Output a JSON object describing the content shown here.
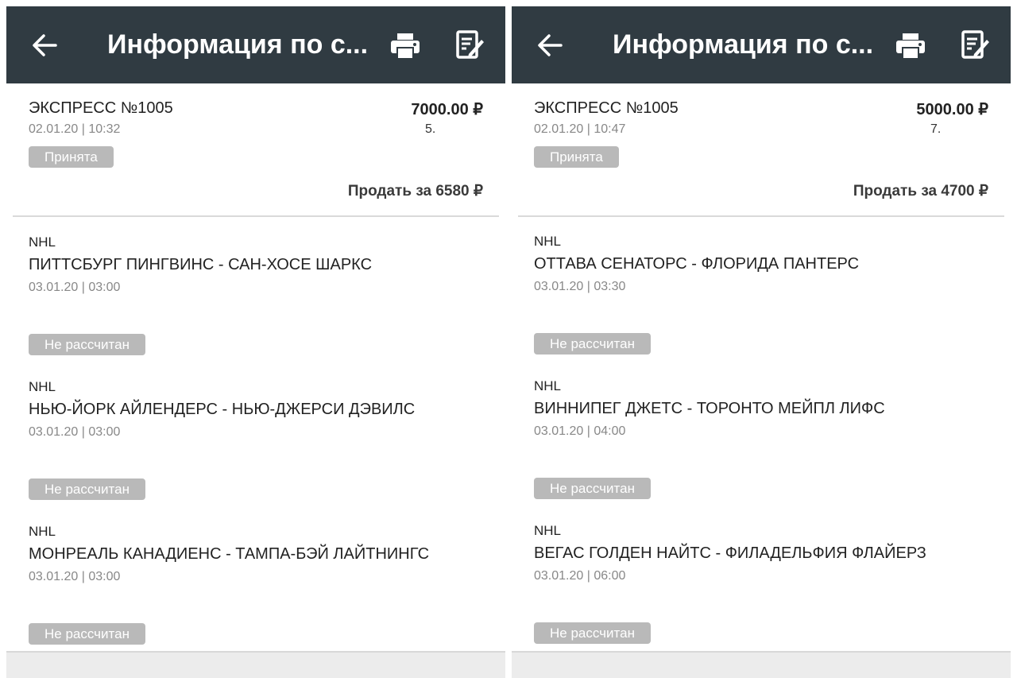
{
  "panels": [
    {
      "appbar": {
        "title": "Информация по с..."
      },
      "summary": {
        "title": "ЭКСПРЕСС №1005",
        "date": "02.01.20 | 10:32",
        "amount": "7000.00 ₽",
        "coef": "5.",
        "status": "Принята",
        "sell": "Продать за 6580 ₽"
      },
      "events": [
        {
          "league": "NHL",
          "name": "ПИТТСБУРГ ПИНГВИНС - САН-ХОСЕ ШАРКС",
          "date": "03.01.20 | 03:00",
          "status": "Не рассчитан"
        },
        {
          "league": "NHL",
          "name": "НЬЮ-ЙОРК АЙЛЕНДЕРС - НЬЮ-ДЖЕРСИ ДЭВИЛС",
          "date": "03.01.20 | 03:00",
          "status": "Не рассчитан"
        },
        {
          "league": "NHL",
          "name": "МОНРЕАЛЬ КАНАДИЕНС - ТАМПА-БЭЙ ЛАЙТНИНГС",
          "date": "03.01.20 | 03:00",
          "status": "Не рассчитан"
        }
      ]
    },
    {
      "appbar": {
        "title": "Информация по с..."
      },
      "summary": {
        "title": "ЭКСПРЕСС №1005",
        "date": "02.01.20 | 10:47",
        "amount": "5000.00 ₽",
        "coef": "7.",
        "status": "Принята",
        "sell": "Продать за 4700 ₽"
      },
      "events": [
        {
          "league": "NHL",
          "name": "ОТТАВА СЕНАТОРС - ФЛОРИДА ПАНТЕРС",
          "date": "03.01.20 | 03:30",
          "status": "Не рассчитан"
        },
        {
          "league": "NHL",
          "name": "ВИННИПЕГ ДЖЕТС - ТОРОНТО МЕЙПЛ ЛИФС",
          "date": "03.01.20 | 04:00",
          "status": "Не рассчитан"
        },
        {
          "league": "NHL",
          "name": "ВЕГАС ГОЛДЕН НАЙТС - ФИЛАДЕЛЬФИЯ ФЛАЙЕРЗ",
          "date": "03.01.20 | 06:00",
          "status": "Не рассчитан"
        }
      ]
    }
  ],
  "colors": {
    "appbar": "#303b42",
    "badge": "#b9b9b9",
    "divider": "#dadada"
  },
  "icons": [
    "arrow-left-icon",
    "printer-icon",
    "edit-note-icon"
  ]
}
